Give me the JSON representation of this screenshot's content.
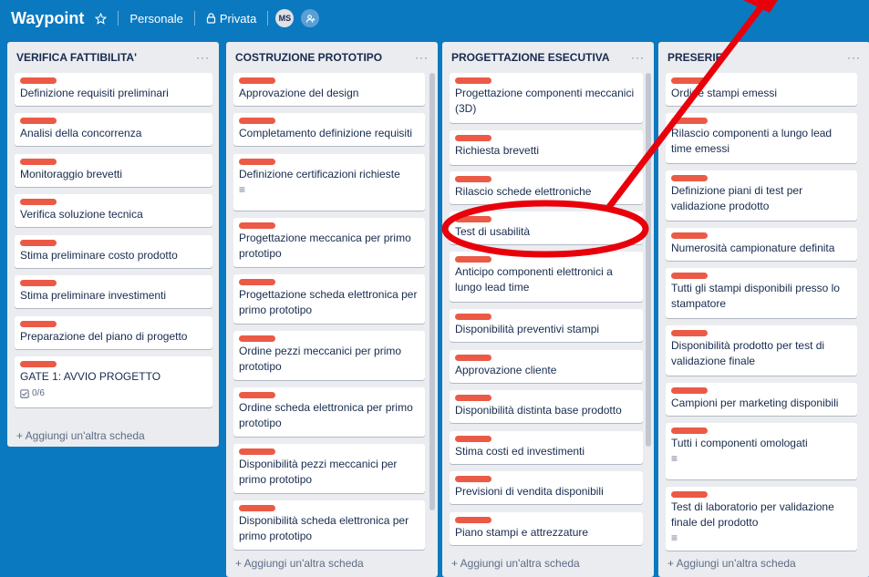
{
  "header": {
    "board_title": "Waypoint",
    "star_icon": "star-icon",
    "team": "Personale",
    "visibility": "Privata",
    "avatar_initials": "MS",
    "add_member_icon": "add-member-icon"
  },
  "lists": [
    {
      "title": "VERIFICA FATTIBILITA'",
      "cards": [
        {
          "text": "Definizione requisiti preliminari"
        },
        {
          "text": "Analisi della concorrenza"
        },
        {
          "text": "Monitoraggio brevetti"
        },
        {
          "text": "Verifica soluzione tecnica"
        },
        {
          "text": "Stima preliminare costo prodotto"
        },
        {
          "text": "Stima preliminare investimenti"
        },
        {
          "text": "Preparazione del piano di progetto"
        },
        {
          "text": "GATE 1: AVVIO PROGETTO",
          "checklist": "0/6"
        }
      ],
      "add_card": "+ Aggiungi un'altra scheda"
    },
    {
      "title": "COSTRUZIONE PROTOTIPO",
      "cards": [
        {
          "text": "Approvazione del design"
        },
        {
          "text": "Completamento definizione requisiti"
        },
        {
          "text": "Definizione certificazioni richieste",
          "description": true
        },
        {
          "text": "Progettazione meccanica per primo prototipo"
        },
        {
          "text": "Progettazione scheda elettronica per primo prototipo"
        },
        {
          "text": "Ordine pezzi meccanici per primo prototipo"
        },
        {
          "text": "Ordine scheda elettronica per primo prototipo"
        },
        {
          "text": "Disponibilità pezzi meccanici per primo prototipo"
        },
        {
          "text": "Disponibilità scheda elettronica per primo prototipo"
        }
      ],
      "add_card": "+ Aggiungi un'altra scheda"
    },
    {
      "title": "PROGETTAZIONE ESECUTIVA",
      "cards": [
        {
          "text": "Progettazione componenti meccanici (3D)"
        },
        {
          "text": "Richiesta brevetti"
        },
        {
          "text": "Rilascio schede elettroniche"
        },
        {
          "text": "Test di usabilità"
        },
        {
          "text": "Anticipo componenti elettronici a lungo lead time"
        },
        {
          "text": "Disponibilità preventivi stampi"
        },
        {
          "text": "Approvazione cliente"
        },
        {
          "text": "Disponibilità distinta base prodotto"
        },
        {
          "text": "Stima costi ed investimenti"
        },
        {
          "text": "Previsioni di vendita disponibili"
        },
        {
          "text": "Piano stampi e attrezzature"
        }
      ],
      "add_card": "+ Aggiungi un'altra scheda"
    },
    {
      "title": "PRESERIE",
      "cards": [
        {
          "text": "Ordine stampi emessi"
        },
        {
          "text": "Rilascio componenti a lungo lead time emessi"
        },
        {
          "text": "Definizione piani di test per validazione prodotto"
        },
        {
          "text": "Numerosità campionature definita"
        },
        {
          "text": "Tutti gli stampi disponibili presso lo stampatore"
        },
        {
          "text": "Disponibilità prodotto per test di validazione finale"
        },
        {
          "text": "Campioni per marketing disponibili"
        },
        {
          "text": "Tutti i componenti omologati",
          "description": true
        },
        {
          "text": "Test di laboratorio per validazione finale del prodotto",
          "description": true
        }
      ],
      "add_card": "+ Aggiungi un'altra scheda"
    }
  ],
  "colors": {
    "board_bg": "#0b79bf",
    "list_bg": "#ebecf0",
    "label_red": "#eb5a46",
    "annotation_red": "#e8000b"
  }
}
